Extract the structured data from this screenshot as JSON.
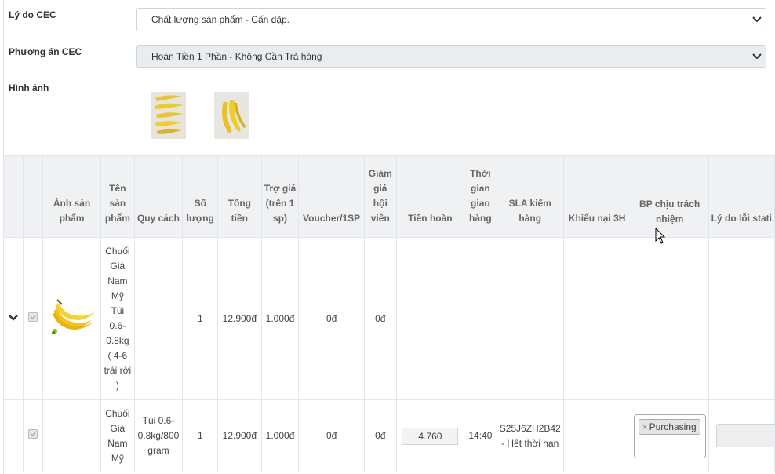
{
  "form": {
    "reason_label": "Lý do CEC",
    "reason_value": "Chất lượng sản phẩm - Cấn dập.",
    "plan_label": "Phương án CEC",
    "plan_value": "Hoàn Tiền 1 Phần - Không Cần Trả hàng",
    "images_label": "Hình ảnh"
  },
  "table": {
    "headers": {
      "image": "Ảnh sản phẩm",
      "name": "Tên sản phẩm",
      "spec": "Quy cách",
      "qty": "Số lượng",
      "total": "Tổng tiền",
      "subsidy": "Trợ giá (trên 1 sp)",
      "voucher": "Voucher/1SP",
      "member_discount": "Giảm giá hội viên",
      "refund": "Tiền hoàn",
      "delivery_time": "Thời gian giao hàng",
      "sla": "SLA kiểm hàng",
      "complaint": "Khiếu nại 3H",
      "responsible": "BP chịu trách nhiệm",
      "error_reason": "Lý do lỗi stati"
    },
    "rows": [
      {
        "name": "Chuối Già Nam Mỹ Túi 0.6-0.8kg ( 4-6 trái rời )",
        "spec": "",
        "qty": "1",
        "total": "12.900đ",
        "subsidy": "1.000đ",
        "voucher": "0đ",
        "member_discount": "0đ",
        "refund": "",
        "delivery_time": "",
        "sla": ""
      },
      {
        "name": "Chuối Già Nam Mỹ",
        "spec": "Túi 0.6-0.8kg/800 gram",
        "qty": "1",
        "total": "12.900đ",
        "subsidy": "1.000đ",
        "voucher": "0đ",
        "member_discount": "0đ",
        "refund": "4.760",
        "delivery_time": "14:40",
        "sla": "S25J6ZH2B42 - Hết thời hạn",
        "responsible_tag": "Purchasing"
      }
    ]
  },
  "icons": {
    "expand": "chevron-down-icon",
    "select_arrow": "chevron-down-icon",
    "tag_remove": "×"
  },
  "colors": {
    "header_bg": "#eff1f3",
    "select_disabled_bg": "#eaedf0",
    "banana_yellow": "#f2c41b"
  }
}
